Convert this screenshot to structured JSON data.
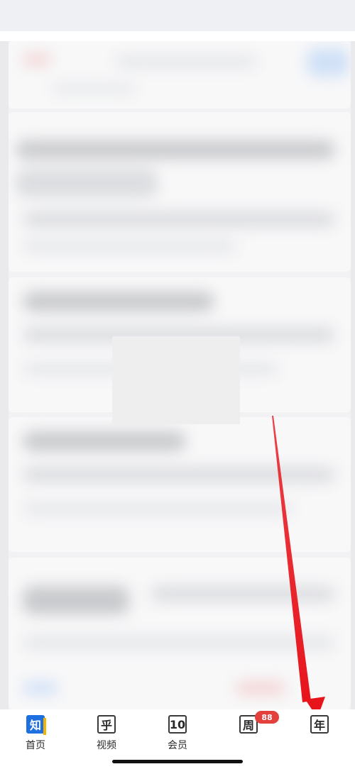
{
  "tabbar": {
    "items": [
      {
        "label": "首页",
        "icon_char": "知",
        "icon": "zhi-logo-icon",
        "active": true
      },
      {
        "label": "视频",
        "icon_char": "乎",
        "icon": "video-icon",
        "active": false
      },
      {
        "label": "会员",
        "icon_char": "10",
        "icon": "vip-icon",
        "active": false
      },
      {
        "label": "",
        "icon_char": "周",
        "icon": "message-icon",
        "active": false,
        "badge": "88"
      },
      {
        "label": "",
        "icon_char": "年",
        "icon": "profile-icon",
        "active": false
      }
    ]
  },
  "colors": {
    "accent": "#1e6fe0",
    "badge": "#e3413e",
    "annotation_arrow": "#e8141c"
  }
}
